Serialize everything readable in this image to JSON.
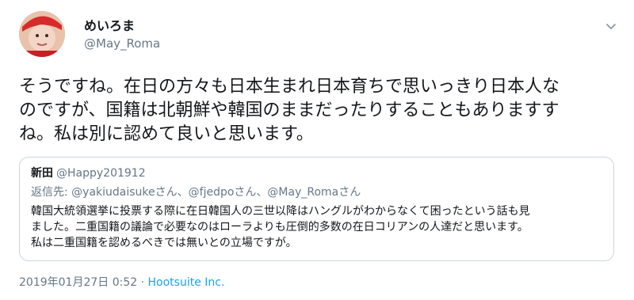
{
  "tweet": {
    "display_name": "めいろま",
    "handle": "@May_Roma",
    "avatar_icon": "profile-photo-avatar",
    "menu_icon": "chevron-down-icon",
    "text_lines": [
      "そうですね。在日の方々も日本生まれ日本育ちで思いっきり日本人な",
      "のですが、国籍は北朝鮮や韓国のままだったりすることもありますす",
      "ね。私は別に認めて良いと思います。"
    ],
    "timestamp": "2019年01月27日 0:52",
    "separator": "·",
    "source": "Hootsuite Inc."
  },
  "quote": {
    "display_name": "新田",
    "handle": "@Happy201912",
    "reply_prefix": "返信先: ",
    "reply_mentions": "@yakiudaisukeさん、@fjedpoさん、@May_Romaさん",
    "text_lines": [
      "韓国大統領選挙に投票する際に在日韓国人の三世以降はハングルがわからなくて困ったという話も見",
      "ました。二重国籍の議論で必要なのはローラよりも圧倒的多数の在日コリアンの人達だと思います。",
      "私は二重国籍を認めるべきでは無いとの立場ですが。"
    ]
  },
  "colors": {
    "text": "#14171a",
    "secondary": "#657786",
    "link": "#1da1f2",
    "border": "#ccd6dd"
  }
}
